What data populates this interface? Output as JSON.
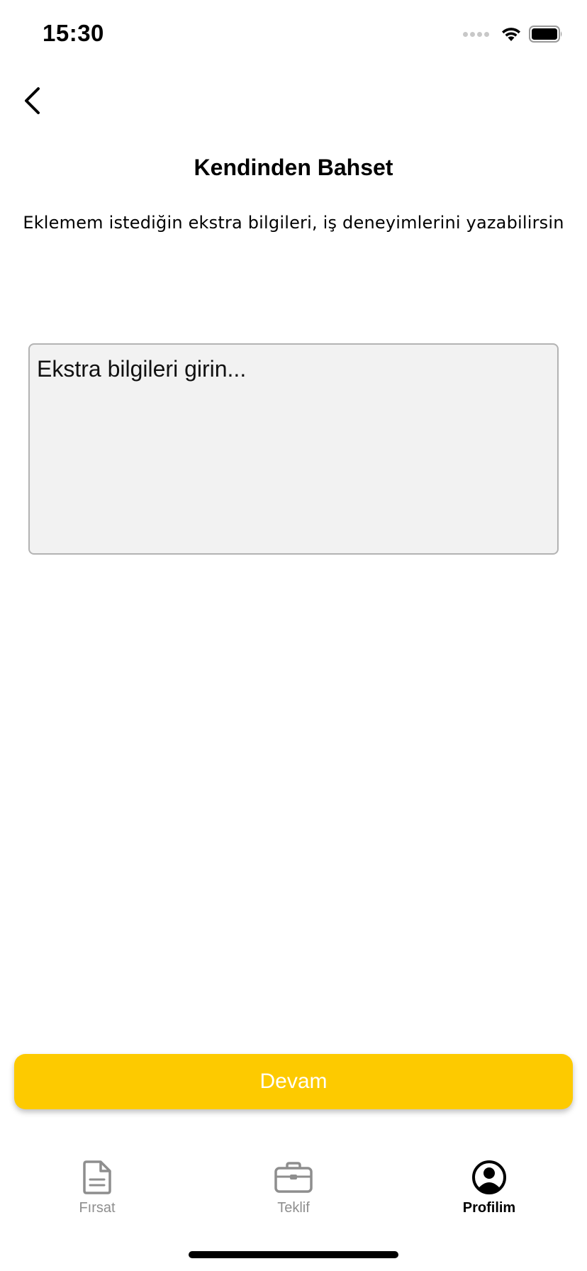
{
  "status_bar": {
    "time": "15:30",
    "icons": [
      "signal-icon",
      "wifi-icon",
      "battery-icon"
    ]
  },
  "header": {
    "back_icon": "chevron-left-icon",
    "title": "Kendinden Bahset",
    "subtitle": "Eklemem istediğin ekstra bilgileri, iş deneyimlerini yazabilirsin"
  },
  "form": {
    "extra_info": {
      "value": "",
      "placeholder": "Ekstra bilgileri girin..."
    }
  },
  "actions": {
    "continue_label": "Devam"
  },
  "tab_bar": {
    "items": [
      {
        "label": "Fırsat",
        "icon": "document-icon",
        "active": false
      },
      {
        "label": "Teklif",
        "icon": "briefcase-icon",
        "active": false
      },
      {
        "label": "Profilim",
        "icon": "profile-icon",
        "active": true
      }
    ]
  },
  "colors": {
    "accent": "#FDCA00",
    "inactive_tab": "#8E8E8E",
    "input_background": "#F2F2F2",
    "input_border": "#B3B3B3"
  }
}
